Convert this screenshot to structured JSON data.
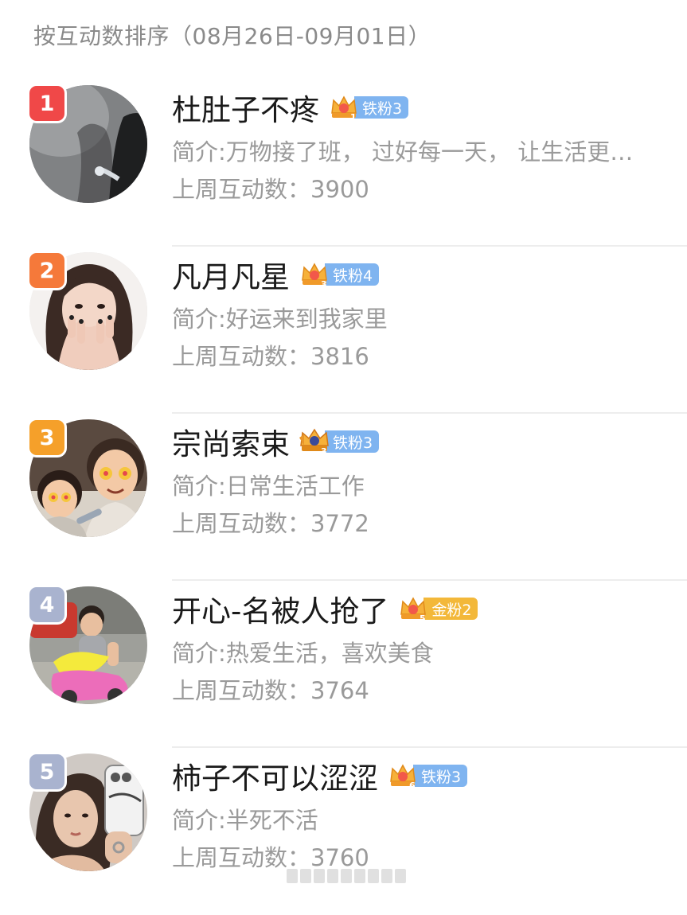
{
  "header": {
    "title": "按互动数排序（08月26日-09月01日）"
  },
  "colors": {
    "rank1": "#f04848",
    "rank2": "#f5793a",
    "rank3": "#f5a02a",
    "rank4_5": "#a9b3cf",
    "iron_fan": "#7fb4f0",
    "gold_fan": "#f3b83a"
  },
  "users": [
    {
      "rank": "1",
      "name": "杜肚子不疼",
      "crown_level": "1",
      "badge": "铁粉3",
      "intro": "简介:万物接了班， 过好每一天， 让生活更…",
      "count": "上周互动数：3900",
      "avatar_icon": "dark-outdoor-photo-icon"
    },
    {
      "rank": "2",
      "name": "凡月凡星",
      "crown_level": "3",
      "badge": "铁粉4",
      "intro": "简介:好运来到我家里",
      "count": "上周互动数：3816",
      "avatar_icon": "woman-portrait-icon"
    },
    {
      "rank": "3",
      "name": "宗尚索束",
      "crown_level": "3",
      "badge": "铁粉3",
      "intro": "简介:日常生活工作",
      "count": "上周互动数：3772",
      "avatar_icon": "cartoon-couple-icon"
    },
    {
      "rank": "4",
      "name": "开心-名被人抢了",
      "crown_level": "5",
      "badge": "金粉2",
      "intro": "简介:热爱生活，喜欢美食",
      "count": "上周互动数：3764",
      "avatar_icon": "child-on-toy-car-icon"
    },
    {
      "rank": "5",
      "name": "柿子不可以涩涩",
      "crown_level": "6",
      "badge": "铁粉3",
      "intro": "简介:半死不活",
      "count": "上周互动数：3760",
      "avatar_icon": "woman-selfie-icon"
    }
  ]
}
